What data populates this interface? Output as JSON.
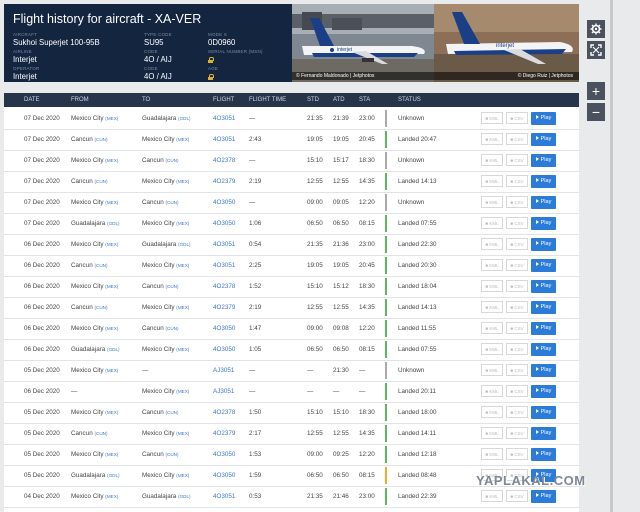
{
  "header": {
    "title": "Flight history for aircraft - XA-VER",
    "aircraft_label": "AIRCRAFT",
    "aircraft_value": "Sukhoi Superjet 100-95B",
    "type_code_label": "TYPE CODE",
    "type_code_value": "SU95",
    "mode_s_label": "MODE S",
    "mode_s_value": "0D0960",
    "airline_label": "AIRLINE",
    "airline_value": "Interjet",
    "code_label": "CODE",
    "code_value": "4O / AIJ",
    "serial_label": "SERIAL NUMBER (MSN)",
    "operator_label": "OPERATOR",
    "operator_value": "Interjet",
    "op_code_label": "CODE",
    "op_code_value": "4O / AIJ",
    "age_label": "AGE"
  },
  "photos": {
    "credit_1": "© Fernando Maldonado | Jetphotos",
    "credit_2": "© Diego Ruiz | Jetphotos",
    "livery_text": "interjet"
  },
  "columns": [
    "DATE",
    "FROM",
    "TO",
    "FLIGHT",
    "FLIGHT TIME",
    "STD",
    "ATD",
    "STA",
    "STATUS"
  ],
  "buttons": {
    "kml": "KML",
    "csv": "CSV",
    "play": "Play"
  },
  "rows": [
    {
      "date": "07 Dec 2020",
      "from": "Mexico City",
      "from_code": "(MEX)",
      "to": "Guadalajara",
      "to_code": "(GDL)",
      "flight": "4O3051",
      "time": "—",
      "std": "21:35",
      "atd": "21:39",
      "sta": "23:00",
      "status": "Unknown",
      "color": "gray"
    },
    {
      "date": "07 Dec 2020",
      "from": "Cancun",
      "from_code": "(CUN)",
      "to": "Mexico City",
      "to_code": "(MEX)",
      "flight": "4O3051",
      "time": "2:43",
      "std": "19:05",
      "atd": "19:05",
      "sta": "20:45",
      "status": "Landed 20:47",
      "color": "green"
    },
    {
      "date": "07 Dec 2020",
      "from": "Mexico City",
      "from_code": "(MEX)",
      "to": "Cancun",
      "to_code": "(CUN)",
      "flight": "4O2378",
      "time": "—",
      "std": "15:10",
      "atd": "15:17",
      "sta": "18:30",
      "status": "Unknown",
      "color": "gray"
    },
    {
      "date": "07 Dec 2020",
      "from": "Cancun",
      "from_code": "(CUN)",
      "to": "Mexico City",
      "to_code": "(MEX)",
      "flight": "4O2379",
      "time": "2:19",
      "std": "12:55",
      "atd": "12:55",
      "sta": "14:35",
      "status": "Landed 14:13",
      "color": "green"
    },
    {
      "date": "07 Dec 2020",
      "from": "Mexico City",
      "from_code": "(MEX)",
      "to": "Cancun",
      "to_code": "(CUN)",
      "flight": "4O3050",
      "time": "—",
      "std": "09:00",
      "atd": "09:05",
      "sta": "12:20",
      "status": "Unknown",
      "color": "gray"
    },
    {
      "date": "07 Dec 2020",
      "from": "Guadalajara",
      "from_code": "(GDL)",
      "to": "Mexico City",
      "to_code": "(MEX)",
      "flight": "4O3050",
      "time": "1:06",
      "std": "06:50",
      "atd": "06:50",
      "sta": "08:15",
      "status": "Landed 07:55",
      "color": "green"
    },
    {
      "date": "06 Dec 2020",
      "from": "Mexico City",
      "from_code": "(MEX)",
      "to": "Guadalajara",
      "to_code": "(GDL)",
      "flight": "4O3051",
      "time": "0:54",
      "std": "21:35",
      "atd": "21:36",
      "sta": "23:00",
      "status": "Landed 22:30",
      "color": "green"
    },
    {
      "date": "06 Dec 2020",
      "from": "Cancun",
      "from_code": "(CUN)",
      "to": "Mexico City",
      "to_code": "(MEX)",
      "flight": "4O3051",
      "time": "2:25",
      "std": "19:05",
      "atd": "19:05",
      "sta": "20:45",
      "status": "Landed 20:30",
      "color": "green"
    },
    {
      "date": "06 Dec 2020",
      "from": "Mexico City",
      "from_code": "(MEX)",
      "to": "Cancun",
      "to_code": "(CUN)",
      "flight": "4O2378",
      "time": "1:52",
      "std": "15:10",
      "atd": "15:12",
      "sta": "18:30",
      "status": "Landed 18:04",
      "color": "green"
    },
    {
      "date": "06 Dec 2020",
      "from": "Cancun",
      "from_code": "(CUN)",
      "to": "Mexico City",
      "to_code": "(MEX)",
      "flight": "4O2379",
      "time": "2:19",
      "std": "12:55",
      "atd": "12:55",
      "sta": "14:35",
      "status": "Landed 14:13",
      "color": "green"
    },
    {
      "date": "06 Dec 2020",
      "from": "Mexico City",
      "from_code": "(MEX)",
      "to": "Cancun",
      "to_code": "(CUN)",
      "flight": "4O3050",
      "time": "1:47",
      "std": "09:00",
      "atd": "09:08",
      "sta": "12:20",
      "status": "Landed 11:55",
      "color": "green"
    },
    {
      "date": "06 Dec 2020",
      "from": "Guadalajara",
      "from_code": "(GDL)",
      "to": "Mexico City",
      "to_code": "(MEX)",
      "flight": "4O3050",
      "time": "1:05",
      "std": "06:50",
      "atd": "06:50",
      "sta": "08:15",
      "status": "Landed 07:55",
      "color": "green"
    },
    {
      "date": "05 Dec 2020",
      "from": "Mexico City",
      "from_code": "(MEX)",
      "to": "—",
      "to_code": "",
      "flight": "AJ3051",
      "time": "—",
      "std": "—",
      "atd": "21:30",
      "sta": "—",
      "status": "Unknown",
      "color": "gray"
    },
    {
      "date": "06 Dec 2020",
      "from": "—",
      "from_code": "",
      "to": "Mexico City",
      "to_code": "(MEX)",
      "flight": "AJ3051",
      "time": "—",
      "std": "—",
      "atd": "—",
      "sta": "—",
      "status": "Landed 20:11",
      "color": "green"
    },
    {
      "date": "05 Dec 2020",
      "from": "Mexico City",
      "from_code": "(MEX)",
      "to": "Cancun",
      "to_code": "(CUN)",
      "flight": "4O2378",
      "time": "1:50",
      "std": "15:10",
      "atd": "15:10",
      "sta": "18:30",
      "status": "Landed 18:00",
      "color": "green"
    },
    {
      "date": "05 Dec 2020",
      "from": "Cancun",
      "from_code": "(CUN)",
      "to": "Mexico City",
      "to_code": "(MEX)",
      "flight": "4O2379",
      "time": "2:17",
      "std": "12:55",
      "atd": "12:55",
      "sta": "14:35",
      "status": "Landed 14:11",
      "color": "green"
    },
    {
      "date": "05 Dec 2020",
      "from": "Mexico City",
      "from_code": "(MEX)",
      "to": "Cancun",
      "to_code": "(CUN)",
      "flight": "4O3050",
      "time": "1:53",
      "std": "09:00",
      "atd": "09:25",
      "sta": "12:20",
      "status": "Landed 12:18",
      "color": "green"
    },
    {
      "date": "05 Dec 2020",
      "from": "Guadalajara",
      "from_code": "(GDL)",
      "to": "Mexico City",
      "to_code": "(MEX)",
      "flight": "4O3050",
      "time": "1:59",
      "std": "06:50",
      "atd": "06:50",
      "sta": "08:15",
      "status": "Landed 08:48",
      "color": "yellow"
    },
    {
      "date": "04 Dec 2020",
      "from": "Mexico City",
      "from_code": "(MEX)",
      "to": "Guadalajara",
      "to_code": "(GDL)",
      "flight": "4O3051",
      "time": "0:53",
      "std": "21:35",
      "atd": "21:46",
      "sta": "23:00",
      "status": "Landed 22:39",
      "color": "green"
    }
  ],
  "side_icons": [
    "gear-icon",
    "expand-icon",
    "zoom-in-icon",
    "zoom-out-icon"
  ],
  "watermark": "YAPLAKAL.COM",
  "colors": {
    "header_bg": "#13253f",
    "table_head_bg": "#27354a",
    "link": "#3b78c9",
    "play": "#2b7bd8",
    "landed": "#5cb85c",
    "unknown": "#aaaaaa",
    "late": "#f0ad2a"
  }
}
